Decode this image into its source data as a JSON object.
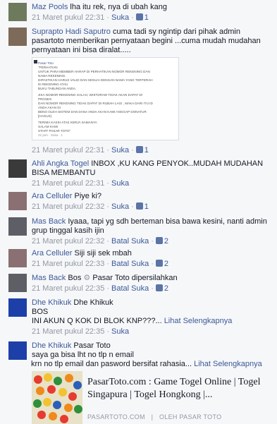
{
  "comments": [
    {
      "name": "Maz Pools",
      "text": "lha itu rek, nya di ubah kang",
      "time": "21 Maret pukul 22:31",
      "like": "Suka",
      "count": "1"
    },
    {
      "name": "Suprapto Hadi Saputro",
      "text": "cuma tadi sy ngintip dari pihak admin pasartoto memberikan pernyataan begini ...cuma mudah mudahan pernyataan ini bisa diralat.....",
      "time": "21 Maret pukul 22:31",
      "like": "Suka",
      "count": "1"
    },
    {
      "name": "Ahli Angka Togel",
      "text": "INBOX ,KU KANG PENYOK..MUDAH MUDAHAN BISA MEMBANTU",
      "time": "21 Maret pukul 22:31",
      "like": "Suka"
    },
    {
      "name": "Ara Celluler",
      "text": "Piye ki?",
      "time": "21 Maret pukul 22:32",
      "like": "Suka",
      "count": "1"
    },
    {
      "name": "Mas Back",
      "text": "Iyaaa, tapi yg sdh berteman bisa bawa kesini, nanti admin grup tinggal kasih ijin",
      "time": "21 Maret pukul 22:32",
      "cancel": "Batal Suka",
      "count": "2"
    },
    {
      "name": "Ara Celluler",
      "text": "Siji siji sek mbah",
      "time": "21 Maret pukul 22:33",
      "cancel": "Batal Suka",
      "count": "2"
    },
    {
      "name": "Mas Back",
      "text_pre": "Bos",
      "mention": "Pasar Toto",
      "text": "dipersilahkan",
      "time": "21 Maret pukul 22:35",
      "cancel": "Batal Suka",
      "count": "2"
    },
    {
      "name": "Dhe Khikuk",
      "line1": "Dhe Khikuk",
      "line2": "BOS",
      "line3": "INI AKUN Q KOK DI BLOK KNP???...",
      "more": "Lihat Selengkapnya",
      "time": "21 Maret pukul 22:35",
      "like": "Suka"
    },
    {
      "name": "Dhe Khikuk",
      "line1": "Pasar Toto",
      "line2": "saya ga bisa lht no tlp n email",
      "line3": "krn no tlp email dan pasword bersifat rahasia...",
      "more": "Lihat Selengkapnya"
    }
  ],
  "screenshot_post": {
    "poster": "Pasar Toto",
    "lines": [
      "\"PERHATIAN",
      "UNTUK PARA MEMBER HARAP DI PERHATIKAN NOMOR REKENING DAN",
      "NAMA REKENING.",
      "DIPASTIKAN HARUS VALID DAN SESUAI DENGAN NAMA YANG TERTERAH",
      "DI REKENING ATAU",
      "BUKU TABUNGAN ANDA.",
      "",
      "JIKA NOMOR REKENING SALAH, WHITDRAW TIDAK AKAN DAPAT DI",
      "PROSES",
      "DAN NOMOR REKENING TIDAK DAPAT DI RUBAH LAGI , MAKA DARI ITU ID",
      "ANDA AKAN DI",
      "BENO OLEH SISTEM DAN DANA ANDA AKAN KAMI ANGGAP DONATUR",
      "[HAGUS]",
      "",
      "TERIMA KASIH ATAS KERJA SAMANYA",
      "SALAM KAMI",
      "STAFF PASAR TOTO\""
    ],
    "meta": "22 jam · Suka · 1"
  },
  "link_card": {
    "title": "PasarToto.com : Game Togel Online | Togel Singapura | Togel Hongkong |...",
    "domain": "PASARTOTO.COM",
    "separator": "|",
    "by": "OLEH PASAR TOTO"
  },
  "colors": {
    "link": "#3b5998",
    "meta": "#9197a3",
    "text": "#141823"
  }
}
